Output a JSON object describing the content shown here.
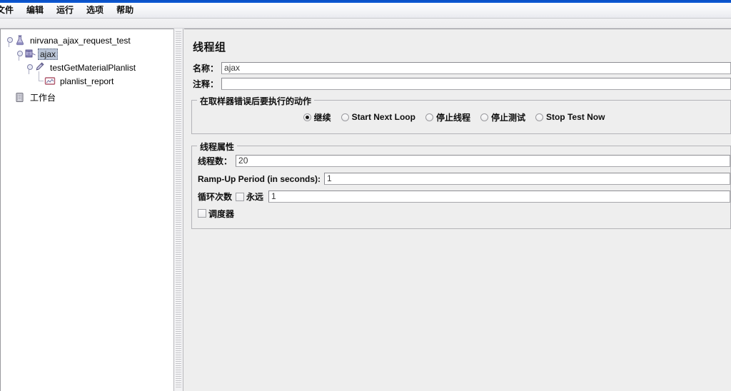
{
  "window": {
    "accent_color": "#0a55cf",
    "panel_bg": "#eeeeee"
  },
  "menubar": {
    "items": [
      {
        "label": "文件",
        "name": "menu-file"
      },
      {
        "label": "编辑",
        "name": "menu-edit"
      },
      {
        "label": "运行",
        "name": "menu-run"
      },
      {
        "label": "选项",
        "name": "menu-options"
      },
      {
        "label": "帮助",
        "name": "menu-help"
      }
    ]
  },
  "tree": {
    "nodes": [
      {
        "label": "nirvana_ajax_request_test",
        "icon": "test-plan-flask-icon",
        "selected": false
      },
      {
        "label": "ajax",
        "icon": "thread-group-spool-icon",
        "selected": true
      },
      {
        "label": "testGetMaterialPlanlist",
        "icon": "sampler-pin-icon",
        "selected": false
      },
      {
        "label": "planlist_report",
        "icon": "listener-graph-icon",
        "selected": false
      },
      {
        "label": "工作台",
        "icon": "workbench-clipboard-icon",
        "selected": false
      }
    ]
  },
  "content": {
    "title": "线程组",
    "name_label": "名称：",
    "name_value": "ajax",
    "comment_label": "注释：",
    "comment_value": "",
    "error_action": {
      "group_title": "在取样器错误后要执行的动作",
      "options": [
        {
          "label": "继续",
          "checked": true
        },
        {
          "label": "Start Next Loop",
          "checked": false
        },
        {
          "label": "停止线程",
          "checked": false
        },
        {
          "label": "停止测试",
          "checked": false
        },
        {
          "label": "Stop Test Now",
          "checked": false
        }
      ]
    },
    "thread_props": {
      "group_title": "线程属性",
      "threads_label": "线程数：",
      "threads_value": "20",
      "rampup_label": "Ramp-Up Period (in seconds):",
      "rampup_value": "1",
      "loop_label": "循环次数",
      "forever_label": "永远",
      "forever_checked": false,
      "loop_value": "1",
      "scheduler_label": "调度器",
      "scheduler_checked": false
    }
  }
}
